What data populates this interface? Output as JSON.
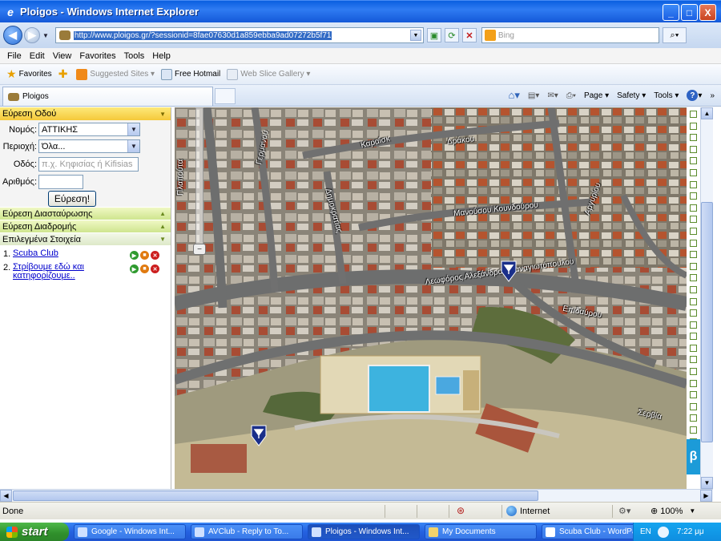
{
  "window": {
    "title": "Ploigos - Windows Internet Explorer",
    "minimize": "_",
    "maximize": "□",
    "close": "X"
  },
  "addressbar": {
    "url": "http://www.ploigos.gr/?sessionid=8fae07630d1a859ebba9ad07272b5f71",
    "search_placeholder": "Bing"
  },
  "menu": [
    "File",
    "Edit",
    "View",
    "Favorites",
    "Tools",
    "Help"
  ],
  "favorites": {
    "favorites_label": "Favorites",
    "items": [
      "Suggested Sites ▾",
      "Free Hotmail",
      "Web Slice Gallery ▾"
    ]
  },
  "tabs": {
    "active": "Ploigos"
  },
  "commandbar": {
    "page": "Page ▾",
    "safety": "Safety ▾",
    "tools": "Tools ▾",
    "help": "?",
    "more": "»"
  },
  "leftpanel": {
    "section_find_street": "Εύρεση Οδού",
    "prefecture_label": "Νομός:",
    "prefecture_value": "ΑΤΤΙΚΗΣ",
    "area_label": "Περιοχή:",
    "area_value": "Όλα...",
    "street_label": "Οδός:",
    "street_placeholder": "π.χ. Κηφισίας ή Kifisias",
    "number_label": "Αριθμός:",
    "find_button": "Εύρεση!",
    "section_intersection": "Εύρεση Διασταύρωσης",
    "section_route": "Εύρεση Διαδρομής",
    "section_selected": "Επιλεγμένα Στοιχεία",
    "items": [
      {
        "num": "1.",
        "label": "Scuba Club"
      },
      {
        "num": "2.",
        "label": "Στρίβουμε εδώ και κατηφορίζουμε.."
      }
    ]
  },
  "map": {
    "streets": [
      "Πλαπούτα",
      "Γερμανού",
      "Καραΐσκ",
      "Δράκου",
      "Δημοκρατίας",
      "Μανούσου Κουνδούρου",
      "Αργυρίου",
      "Λεωφόρος Αλεξάνδρου Παναγιωτόπουλου",
      "Επιδαύρου",
      "Σερβία"
    ],
    "zoom_minus": "−",
    "beta_tab": "β"
  },
  "statusbar": {
    "status": "Done",
    "zone": "Internet",
    "zoom": "100%"
  },
  "taskbar": {
    "start": "start",
    "tasks": [
      "Google - Windows Int...",
      "AVClub - Reply to To...",
      "Ploigos - Windows Int...",
      "My Documents",
      "Scuba Club - WordPad"
    ],
    "lang": "EN",
    "clock": "7:22 μμ"
  },
  "colors": {
    "panel_header_yellow": "#f5c93a",
    "panel_header_green": "#cfe58e",
    "link": "#0000cc",
    "pin": "#1a2f8a"
  }
}
